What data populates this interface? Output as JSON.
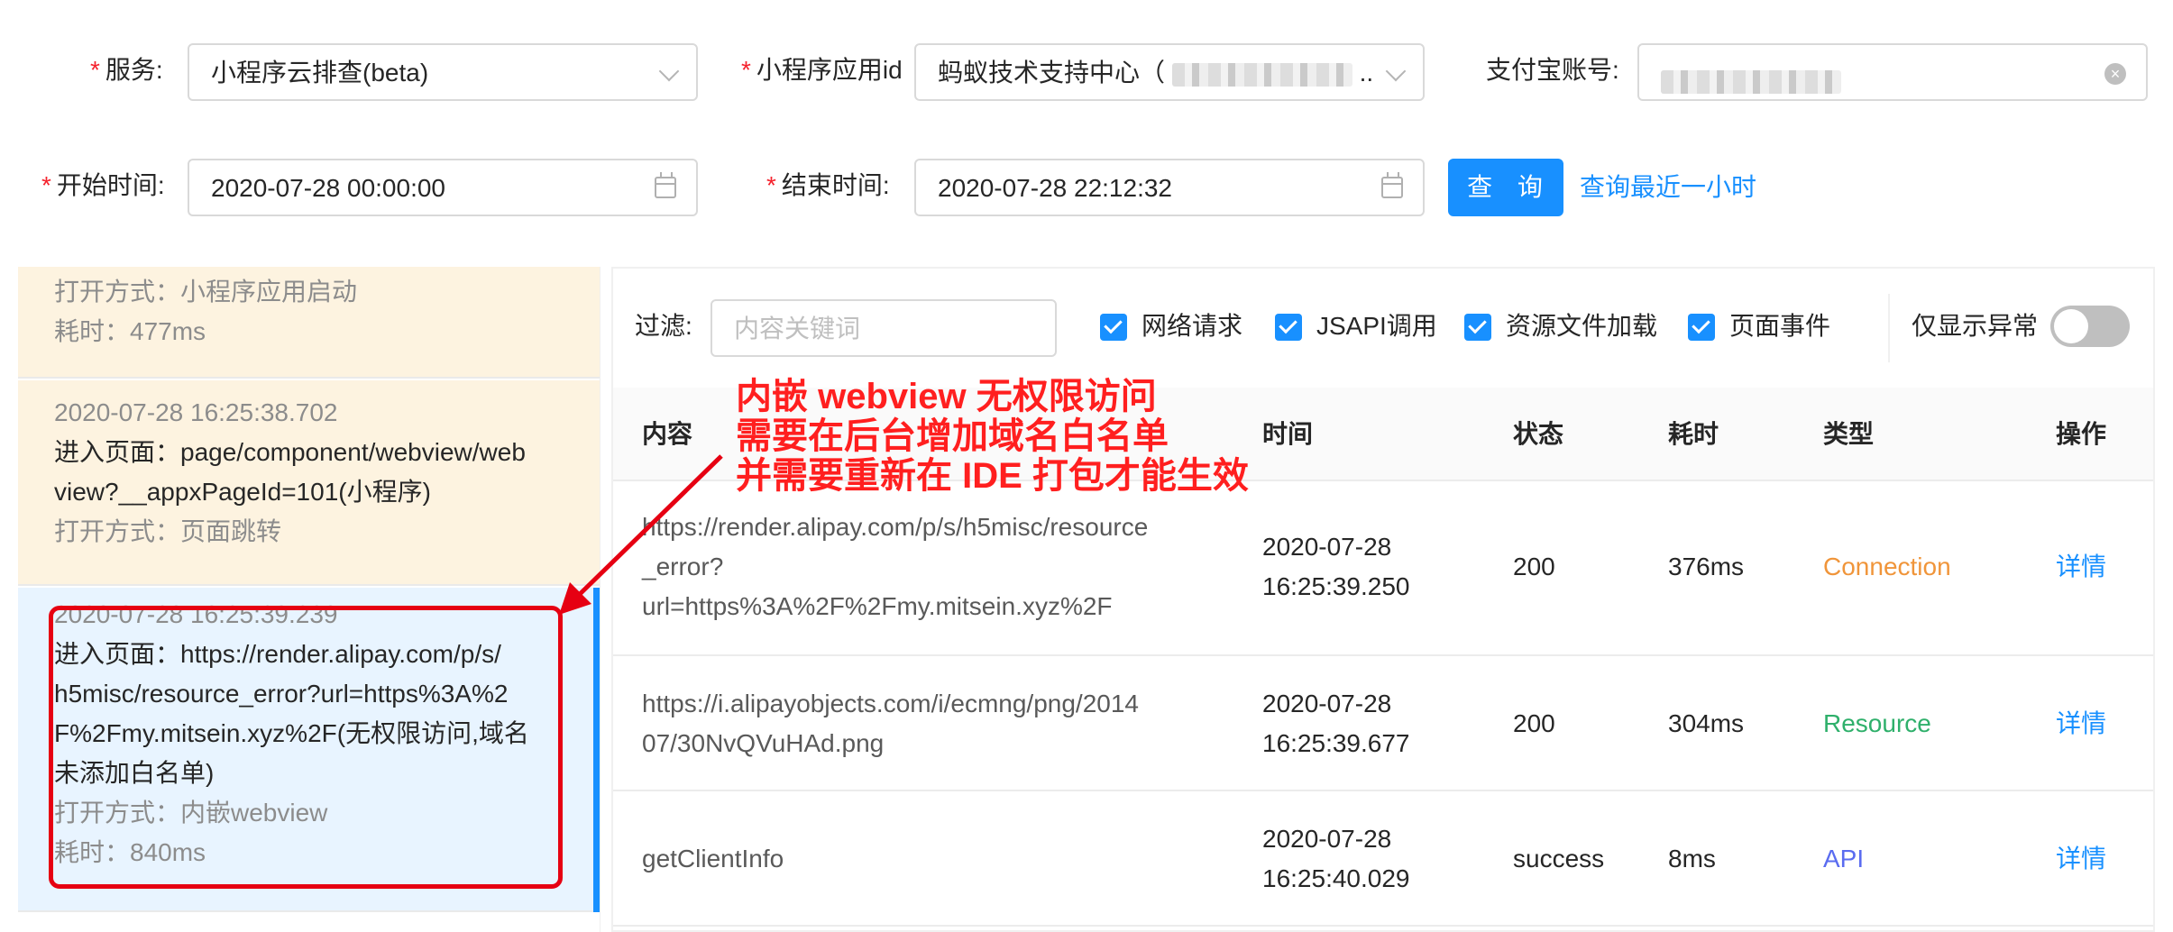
{
  "filters": {
    "service": {
      "label": "服务",
      "value": "小程序云排查(beta)"
    },
    "appid": {
      "label": "小程序应用id",
      "value": "蚂蚁技术支持中心（",
      "suffix": ".."
    },
    "account": {
      "label": "支付宝账号"
    },
    "start_time": {
      "label": "开始时间",
      "value": "2020-07-28 00:00:00"
    },
    "end_time": {
      "label": "结束时间",
      "value": "2020-07-28 22:12:32"
    },
    "query_button": "查 询",
    "recent_hour_link": "查询最近一小时",
    "required_mark": "*",
    "colon": ":"
  },
  "timeline": {
    "cards": [
      {
        "lines": [
          "打开方式：小程序应用启动",
          "耗时：477ms"
        ]
      },
      {
        "time": "2020-07-28 16:25:38.702",
        "page": [
          "进入页面：page/component/webview/web",
          "view?__appxPageId=101(小程序)"
        ],
        "open": "打开方式：页面跳转"
      },
      {
        "time": "2020-07-28 16:25:39.239",
        "page": [
          "进入页面：https://render.alipay.com/p/s/",
          "h5misc/resource_error?url=https%3A%2",
          "F%2Fmy.mitsein.xyz%2F(无权限访问,域名",
          "未添加白名单)"
        ],
        "open": "打开方式：内嵌webview",
        "duration": "耗时：840ms"
      }
    ]
  },
  "toolbar": {
    "filter_label": "过滤:",
    "filter_placeholder": "内容关键词",
    "checkboxes": [
      "网络请求",
      "JSAPI调用",
      "资源文件加载",
      "页面事件"
    ],
    "only_error_label": "仅显示异常"
  },
  "table": {
    "headers": [
      "内容",
      "时间",
      "状态",
      "耗时",
      "类型",
      "操作"
    ],
    "rows": [
      {
        "content": [
          "https://render.alipay.com/p/s/h5misc/resource",
          "_error?",
          "url=https%3A%2F%2Fmy.mitsein.xyz%2F"
        ],
        "time": [
          "2020-07-28",
          "16:25:39.250"
        ],
        "status": "200",
        "duration": "376ms",
        "type": "Connection",
        "type_color": "#f0953a",
        "action": "详情"
      },
      {
        "content": [
          "https://i.alipayobjects.com/i/ecmng/png/2014",
          "07/30NvQVuHAd.png"
        ],
        "time": [
          "2020-07-28",
          "16:25:39.677"
        ],
        "status": "200",
        "duration": "304ms",
        "type": "Resource",
        "type_color": "#2fb06b",
        "action": "详情"
      },
      {
        "content": [
          "getClientInfo"
        ],
        "time": [
          "2020-07-28",
          "16:25:40.029"
        ],
        "status": "success",
        "duration": "8ms",
        "type": "API",
        "type_color": "#5a6cf0",
        "action": "详情"
      }
    ]
  },
  "annotation": {
    "lines": [
      "内嵌 webview 无权限访问",
      "需要在后台增加域名白名单",
      "并需要重新在 IDE 打包才能生效"
    ],
    "color": "#ff1f1f"
  },
  "colors": {
    "primary": "#1890ff",
    "selected_bg": "#e8f4ff",
    "warm_bg": "#fdf3e0",
    "required": "#f5222d"
  }
}
